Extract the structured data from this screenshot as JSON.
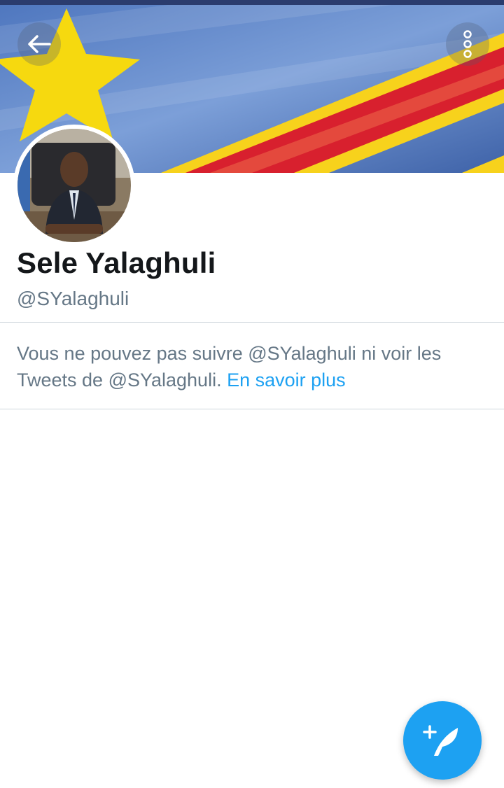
{
  "profile": {
    "display_name": "Sele Yalaghuli",
    "handle": "@SYalaghuli"
  },
  "notice": {
    "text": "Vous ne pouvez pas suivre @SYalaghuli ni voir les Tweets de @SYalaghuli.",
    "link_label": "En savoir plus"
  },
  "icons": {
    "back": "arrow-left-icon",
    "more": "more-vertical-icon",
    "compose": "compose-tweet-icon"
  },
  "colors": {
    "accent": "#1da1f2",
    "name": "#14171a",
    "secondary": "#657786",
    "banner_blue": "#5f86c9",
    "banner_yellow": "#f7d21c",
    "banner_red": "#d8202e"
  }
}
